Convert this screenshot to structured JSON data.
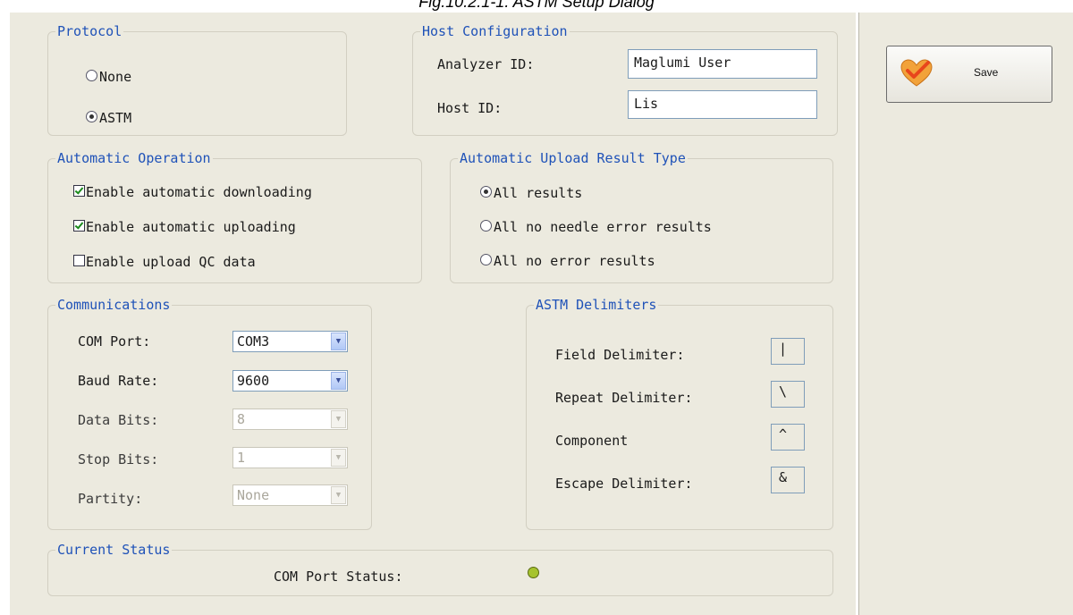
{
  "caption": "Fig.10.2.1-1.  ASTM Setup Dialog",
  "protocol": {
    "legend": "Protocol",
    "options": [
      {
        "label": "None",
        "selected": false
      },
      {
        "label": "ASTM",
        "selected": true
      }
    ]
  },
  "host_config": {
    "legend": "Host Configuration",
    "analyzer_id_label": "Analyzer ID:",
    "analyzer_id_value": "Maglumi User",
    "host_id_label": "Host ID:",
    "host_id_value": "Lis"
  },
  "automatic_operation": {
    "legend": "Automatic Operation",
    "items": [
      {
        "label": "Enable automatic downloading",
        "checked": true
      },
      {
        "label": "Enable automatic uploading",
        "checked": true
      },
      {
        "label": "Enable upload QC data",
        "checked": false
      }
    ]
  },
  "upload_result_type": {
    "legend": "Automatic Upload Result Type",
    "options": [
      {
        "label": "All results",
        "selected": true
      },
      {
        "label": "All no needle error results",
        "selected": false
      },
      {
        "label": "All no error results",
        "selected": false
      }
    ]
  },
  "communications": {
    "legend": "Communications",
    "fields": [
      {
        "label": "COM Port:",
        "value": "COM3",
        "enabled": true
      },
      {
        "label": "Baud Rate:",
        "value": "9600",
        "enabled": true
      },
      {
        "label": "Data Bits:",
        "value": "8",
        "enabled": false
      },
      {
        "label": "Stop Bits:",
        "value": "1",
        "enabled": false
      },
      {
        "label": "Partity:",
        "value": "None",
        "enabled": false
      }
    ]
  },
  "astm_delimiters": {
    "legend": "ASTM Delimiters",
    "fields": [
      {
        "label": "Field Delimiter:",
        "value": "|"
      },
      {
        "label": "Repeat Delimiter:",
        "value": "\\"
      },
      {
        "label": "Component",
        "value": "^"
      },
      {
        "label": "Escape Delimiter:",
        "value": "&"
      }
    ]
  },
  "current_status": {
    "legend": "Current Status",
    "com_port_status_label": "COM Port Status:",
    "status_color": "#a6c32e"
  },
  "toolbar": {
    "save_label": "Save",
    "save_icon": "check-heart-icon"
  }
}
